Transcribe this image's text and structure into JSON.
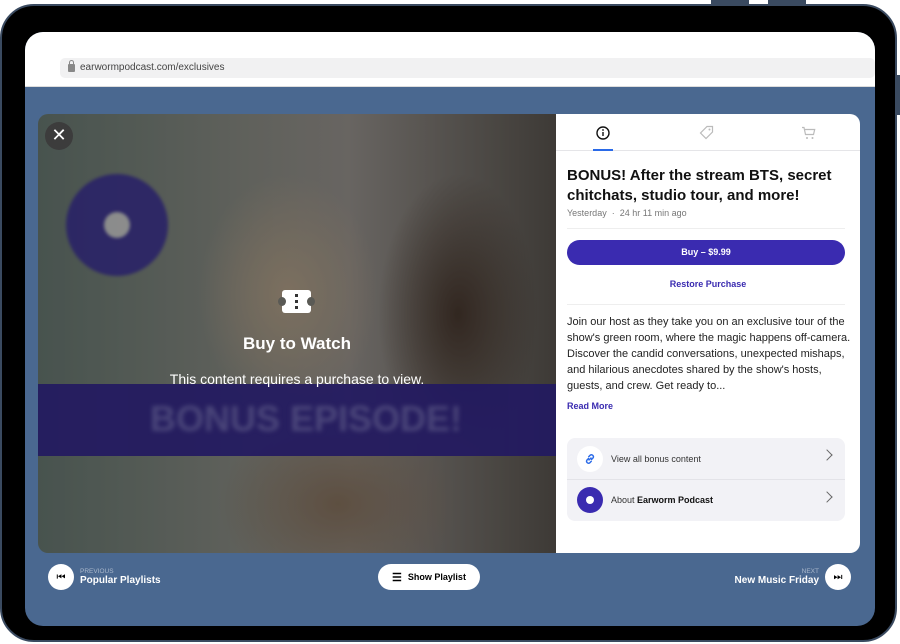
{
  "browser": {
    "url": "earwormpodcast.com/exclusives"
  },
  "video": {
    "banner_text": "BONUS EPISODE!",
    "overlay_title": "Buy to Watch",
    "overlay_message": "This content requires a purchase to view.",
    "close_icon": "close-icon",
    "ticket_icon": "ticket-icon"
  },
  "panel": {
    "tabs": [
      {
        "icon": "info-icon",
        "active": true
      },
      {
        "icon": "tag-icon",
        "active": false
      },
      {
        "icon": "cart-icon",
        "active": false
      }
    ],
    "title": "BONUS! After the stream BTS, secret chitchats, studio tour, and more!",
    "date": "Yesterday",
    "separator": "·",
    "ago": "24 hr 11 min ago",
    "buy_label": "Buy – $9.99",
    "restore_label": "Restore Purchase",
    "description": "Join our host as they take you on an exclusive tour of the show's green room, where the magic happens off-camera. Discover the candid conversations, unexpected mishaps, and hilarious anecdotes shared by the show's hosts, guests, and crew. Get ready to...",
    "read_more": "Read More",
    "links": [
      {
        "label": "View all bonus content",
        "icon": "link-icon"
      },
      {
        "prefix": "About ",
        "bold": "Earworm Podcast",
        "icon": "podcast-logo"
      }
    ]
  },
  "footer": {
    "previous_label": "PREVIOUS",
    "previous_title": "Popular Playlists",
    "show_playlist": "Show Playlist",
    "next_label": "NEXT",
    "next_title": "New Music Friday"
  },
  "colors": {
    "accent": "#3a2bb0",
    "background": "#4a6890",
    "tab_indicator": "#2a6ae8"
  }
}
